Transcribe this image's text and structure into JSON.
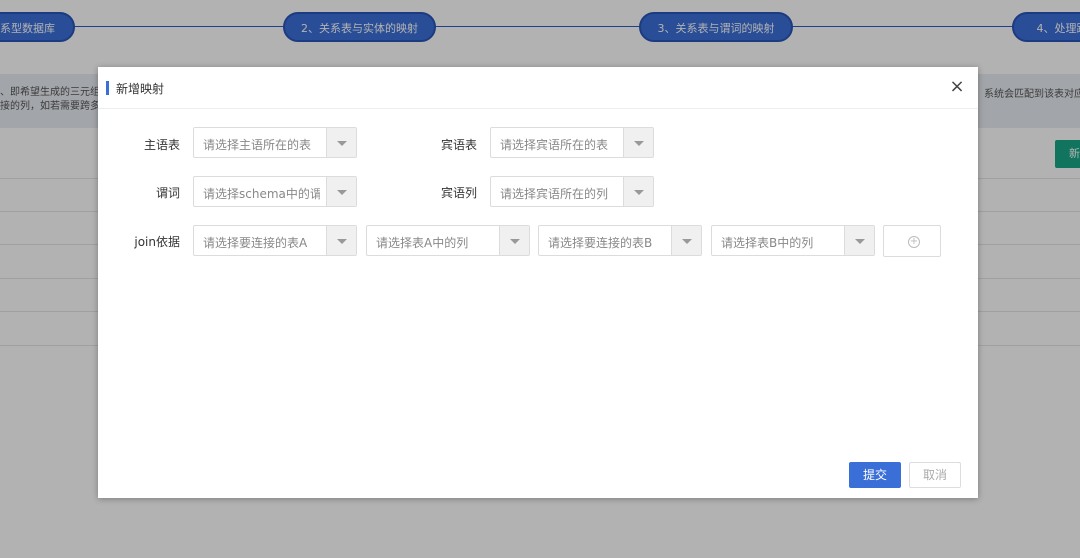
{
  "steps": [
    {
      "label": "系型数据库"
    },
    {
      "label": "2、关系表与实体的映射"
    },
    {
      "label": "3、关系表与谓词的映射"
    },
    {
      "label": "4、处理跨"
    }
  ],
  "info": {
    "left_line1": "、即希望生成的三元组",
    "left_line2": "接的列，如若需要跨多",
    "right_line1": "系统会匹配到该表对应"
  },
  "background": {
    "new_button": "新"
  },
  "modal": {
    "title": "新增映射",
    "close": "×",
    "subject_table": {
      "label": "主语表",
      "placeholder": "请选择主语所在的表"
    },
    "object_table": {
      "label": "宾语表",
      "placeholder": "请选择宾语所在的表"
    },
    "predicate": {
      "label": "谓词",
      "placeholder": "请选择schema中的谓词"
    },
    "object_column": {
      "label": "宾语列",
      "placeholder": "请选择宾语所在的列"
    },
    "join": {
      "label": "join依据",
      "table_a": "请选择要连接的表A",
      "column_a": "请选择表A中的列",
      "table_b": "请选择要连接的表B",
      "column_b": "请选择表B中的列",
      "add": "+"
    },
    "submit": "提交",
    "cancel": "取消"
  },
  "colors": {
    "primary": "#3b6fd8",
    "accent_green": "#18a689"
  }
}
